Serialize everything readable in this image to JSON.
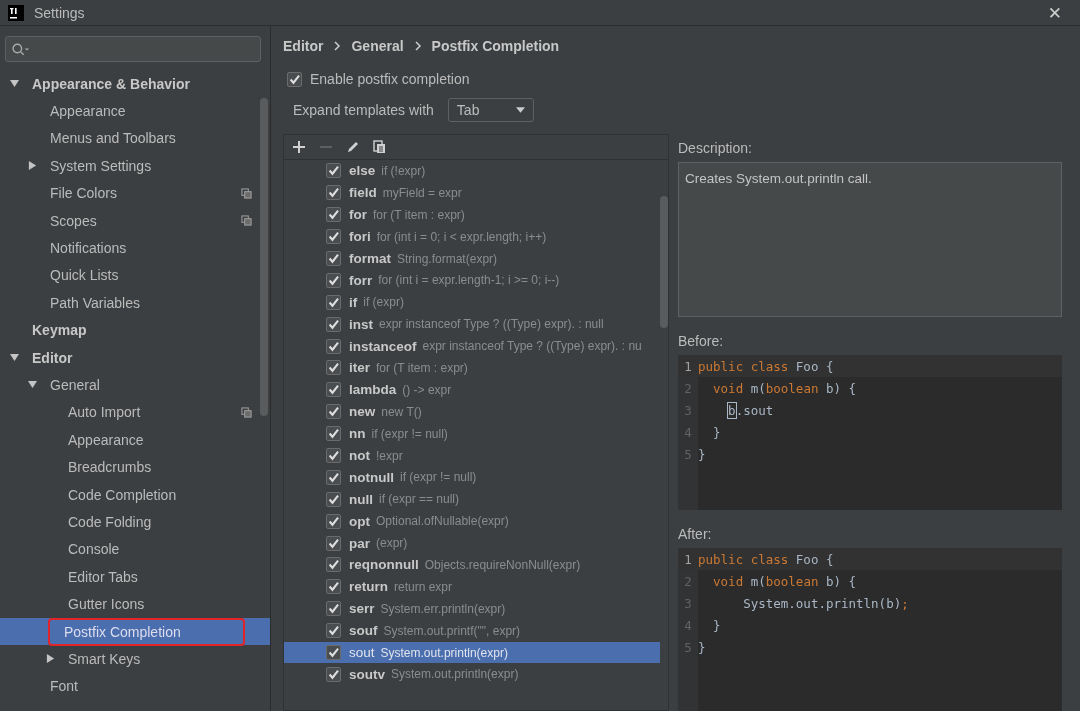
{
  "window": {
    "title": "Settings",
    "close": "✕"
  },
  "sidebar": {
    "items": [
      {
        "label": "Appearance & Behavior",
        "expanded": true,
        "selected": false,
        "project_icon": false,
        "children": [
          {
            "label": "Appearance",
            "selected": false,
            "project_icon": false
          },
          {
            "label": "Menus and Toolbars",
            "selected": false,
            "project_icon": false
          },
          {
            "label": "System Settings",
            "expanded": false,
            "selected": false,
            "project_icon": false
          },
          {
            "label": "File Colors",
            "selected": false,
            "project_icon": true
          },
          {
            "label": "Scopes",
            "selected": false,
            "project_icon": true
          },
          {
            "label": "Notifications",
            "selected": false,
            "project_icon": false
          },
          {
            "label": "Quick Lists",
            "selected": false,
            "project_icon": false
          },
          {
            "label": "Path Variables",
            "selected": false,
            "project_icon": false
          }
        ]
      },
      {
        "label": "Keymap",
        "selected": false,
        "project_icon": false
      },
      {
        "label": "Editor",
        "expanded": true,
        "selected": false,
        "project_icon": false,
        "children": [
          {
            "label": "General",
            "expanded": true,
            "selected": false,
            "project_icon": false,
            "children": [
              {
                "label": "Auto Import",
                "selected": false,
                "project_icon": true
              },
              {
                "label": "Appearance",
                "selected": false,
                "project_icon": false
              },
              {
                "label": "Breadcrumbs",
                "selected": false,
                "project_icon": false
              },
              {
                "label": "Code Completion",
                "selected": false,
                "project_icon": false
              },
              {
                "label": "Code Folding",
                "selected": false,
                "project_icon": false
              },
              {
                "label": "Console",
                "selected": false,
                "project_icon": false
              },
              {
                "label": "Editor Tabs",
                "selected": false,
                "project_icon": false
              },
              {
                "label": "Gutter Icons",
                "selected": false,
                "project_icon": false
              },
              {
                "label": "Postfix Completion",
                "selected": true,
                "project_icon": false
              },
              {
                "label": "Smart Keys",
                "expanded": false,
                "selected": false,
                "project_icon": false
              }
            ]
          },
          {
            "label": "Font",
            "selected": false,
            "project_icon": false
          }
        ]
      }
    ]
  },
  "breadcrumb": [
    "Editor",
    "General",
    "Postfix Completion"
  ],
  "enable_postfix": {
    "label": "Enable postfix completion",
    "checked": true
  },
  "expand_with": {
    "label": "Expand templates with",
    "value": "Tab"
  },
  "templates": [
    {
      "key": "else",
      "example": "if (!expr)",
      "checked": true,
      "selected": false
    },
    {
      "key": "field",
      "example": "myField = expr",
      "checked": true,
      "selected": false
    },
    {
      "key": "for",
      "example": "for (T item : expr)",
      "checked": true,
      "selected": false
    },
    {
      "key": "fori",
      "example": "for (int i = 0; i < expr.length; i++)",
      "checked": true,
      "selected": false
    },
    {
      "key": "format",
      "example": "String.format(expr)",
      "checked": true,
      "selected": false
    },
    {
      "key": "forr",
      "example": "for (int i = expr.length-1; i >= 0; i--)",
      "checked": true,
      "selected": false
    },
    {
      "key": "if",
      "example": "if (expr)",
      "checked": true,
      "selected": false
    },
    {
      "key": "inst",
      "example": "expr instanceof Type ? ((Type) expr). : null",
      "checked": true,
      "selected": false
    },
    {
      "key": "instanceof",
      "example": "expr instanceof Type ? ((Type) expr). : nu",
      "checked": true,
      "selected": false
    },
    {
      "key": "iter",
      "example": "for (T item : expr)",
      "checked": true,
      "selected": false
    },
    {
      "key": "lambda",
      "example": "() -> expr",
      "checked": true,
      "selected": false
    },
    {
      "key": "new",
      "example": "new T()",
      "checked": true,
      "selected": false
    },
    {
      "key": "nn",
      "example": "if (expr != null)",
      "checked": true,
      "selected": false
    },
    {
      "key": "not",
      "example": "!expr",
      "checked": true,
      "selected": false
    },
    {
      "key": "notnull",
      "example": "if (expr != null)",
      "checked": true,
      "selected": false
    },
    {
      "key": "null",
      "example": "if (expr == null)",
      "checked": true,
      "selected": false
    },
    {
      "key": "opt",
      "example": "Optional.ofNullable(expr)",
      "checked": true,
      "selected": false
    },
    {
      "key": "par",
      "example": "(expr)",
      "checked": true,
      "selected": false
    },
    {
      "key": "reqnonnull",
      "example": "Objects.requireNonNull(expr)",
      "checked": true,
      "selected": false
    },
    {
      "key": "return",
      "example": "return expr",
      "checked": true,
      "selected": false
    },
    {
      "key": "serr",
      "example": "System.err.println(expr)",
      "checked": true,
      "selected": false
    },
    {
      "key": "souf",
      "example": "System.out.printf(\"\", expr)",
      "checked": true,
      "selected": false
    },
    {
      "key": "sout",
      "example": "System.out.println(expr)",
      "checked": true,
      "selected": true
    },
    {
      "key": "soutv",
      "example": "System.out.println(expr)",
      "checked": true,
      "selected": false
    }
  ],
  "description": {
    "label": "Description:",
    "text": "Creates System.out.println call."
  },
  "before": {
    "label": "Before:",
    "lines": [
      {
        "number": "1",
        "tokens": [
          {
            "text": "public class ",
            "kind": "keyword"
          },
          {
            "text": "Foo {",
            "kind": "plain"
          }
        ]
      },
      {
        "number": "2",
        "tokens": [
          {
            "text": "  void ",
            "kind": "keyword"
          },
          {
            "text": "m(",
            "kind": "plain"
          },
          {
            "text": "boolean ",
            "kind": "keyword"
          },
          {
            "text": "b) {",
            "kind": "plain"
          }
        ]
      },
      {
        "number": "3",
        "tokens": [
          {
            "text": "    b",
            "kind": "caret"
          },
          {
            "text": ".sout",
            "kind": "plain"
          }
        ]
      },
      {
        "number": "4",
        "tokens": [
          {
            "text": "  }",
            "kind": "plain"
          }
        ]
      },
      {
        "number": "5",
        "tokens": [
          {
            "text": "}",
            "kind": "plain"
          }
        ]
      }
    ]
  },
  "after": {
    "label": "After:",
    "lines": [
      {
        "number": "1",
        "tokens": [
          {
            "text": "public class ",
            "kind": "keyword"
          },
          {
            "text": "Foo {",
            "kind": "plain"
          }
        ]
      },
      {
        "number": "2",
        "tokens": [
          {
            "text": "  void ",
            "kind": "keyword"
          },
          {
            "text": "m(",
            "kind": "plain"
          },
          {
            "text": "boolean ",
            "kind": "keyword"
          },
          {
            "text": "b) {",
            "kind": "plain"
          }
        ]
      },
      {
        "number": "3",
        "tokens": [
          {
            "text": "      System.out.println(b)",
            "kind": "plain"
          },
          {
            "text": ";",
            "kind": "keyword"
          }
        ]
      },
      {
        "number": "4",
        "tokens": [
          {
            "text": "  }",
            "kind": "plain"
          }
        ]
      },
      {
        "number": "5",
        "tokens": [
          {
            "text": "}",
            "kind": "plain"
          }
        ]
      }
    ]
  }
}
